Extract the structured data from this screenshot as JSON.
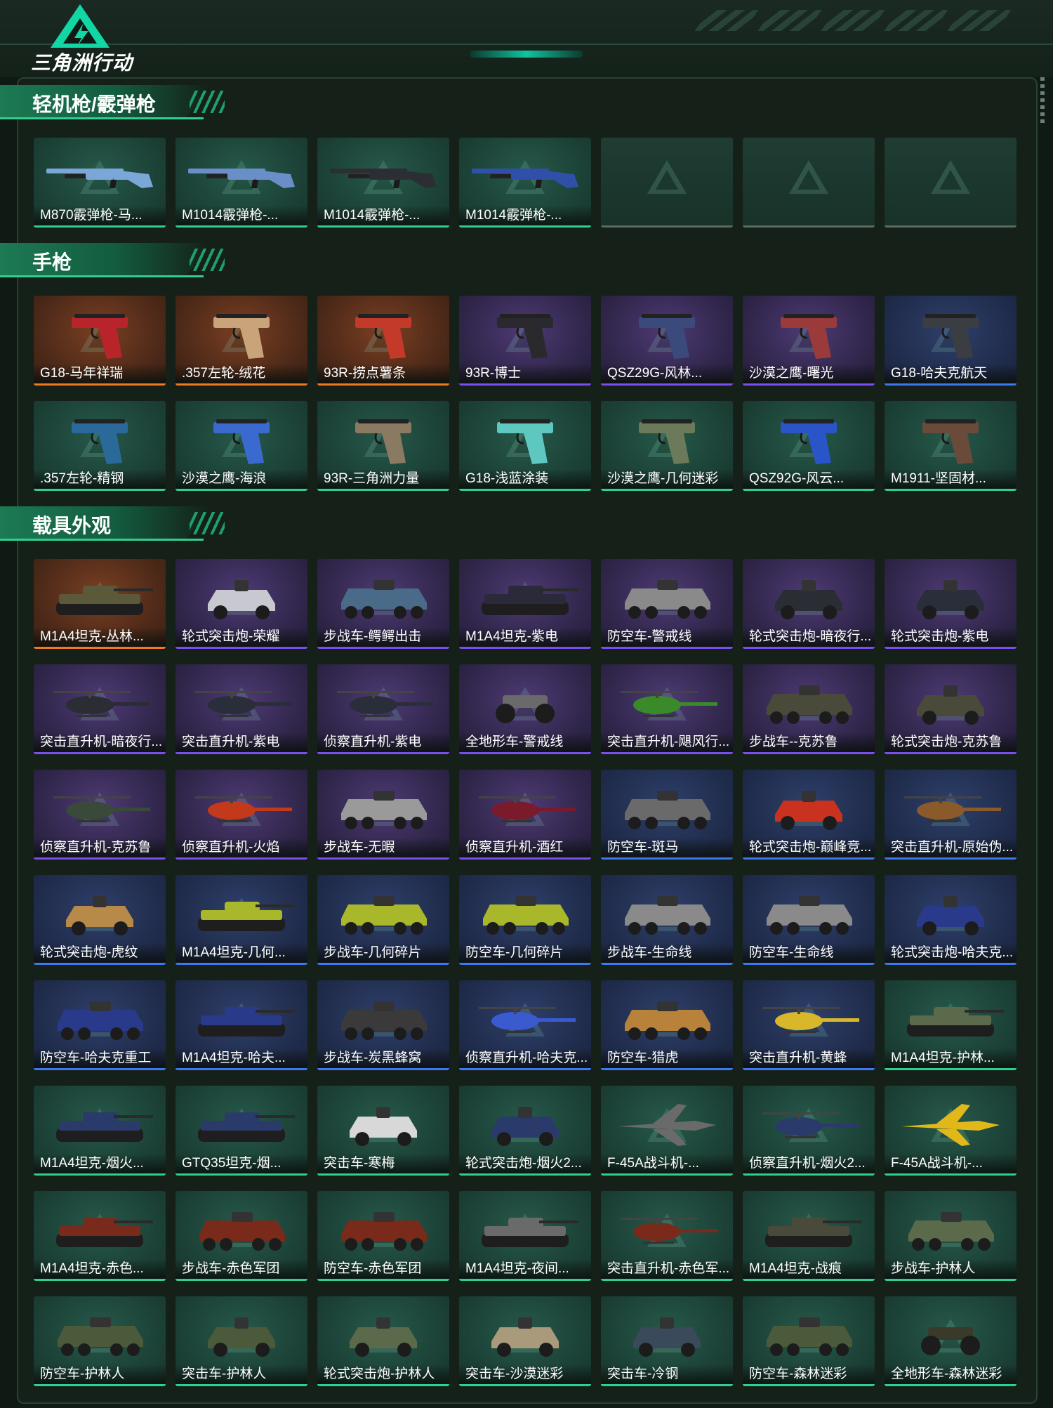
{
  "header": {
    "logo_text": "三角洲行动"
  },
  "sections": [
    {
      "title": "轻机枪/霰弹枪",
      "kind": "gun",
      "items": [
        {
          "name": "M870霰弹枪-马...",
          "rarity": "uncommon",
          "color": "#7aa6d8"
        },
        {
          "name": "M1014霰弹枪-...",
          "rarity": "uncommon",
          "color": "#6a8fc8"
        },
        {
          "name": "M1014霰弹枪-...",
          "rarity": "uncommon",
          "color": "#2b2f33"
        },
        {
          "name": "M1014霰弹枪-...",
          "rarity": "uncommon",
          "color": "#2f4fa8"
        },
        {
          "name": "",
          "rarity": "empty"
        },
        {
          "name": "",
          "rarity": "empty"
        },
        {
          "name": "",
          "rarity": "empty"
        }
      ]
    },
    {
      "title": "手枪",
      "kind": "pistol",
      "items": [
        {
          "name": "G18-马年祥瑞",
          "rarity": "legendary",
          "color": "#b8242a"
        },
        {
          "name": ".357左轮-绒花",
          "rarity": "legendary",
          "color": "#c9a37a"
        },
        {
          "name": "93R-捞点薯条",
          "rarity": "legendary",
          "color": "#c43a2a"
        },
        {
          "name": "93R-博士",
          "rarity": "epic",
          "color": "#2a2a2e"
        },
        {
          "name": "QSZ29G-风林...",
          "rarity": "epic",
          "color": "#3a4a7a"
        },
        {
          "name": "沙漠之鹰-曙光",
          "rarity": "epic",
          "color": "#9a3a3a"
        },
        {
          "name": "G18-哈夫克航天",
          "rarity": "rare",
          "color": "#3a3d42"
        },
        {
          "name": ".357左轮-精钢",
          "rarity": "uncommon",
          "color": "#2a6a9a"
        },
        {
          "name": "沙漠之鹰-海浪",
          "rarity": "uncommon",
          "color": "#3a6ad0"
        },
        {
          "name": "93R-三角洲力量",
          "rarity": "uncommon",
          "color": "#8a7a62"
        },
        {
          "name": "G18-浅蓝涂装",
          "rarity": "uncommon",
          "color": "#5ec8c0"
        },
        {
          "name": "沙漠之鹰-几何迷彩",
          "rarity": "uncommon",
          "color": "#6a7a5a"
        },
        {
          "name": "QSZ92G-风云...",
          "rarity": "uncommon",
          "color": "#2a55c8"
        },
        {
          "name": "M1911-坚固材...",
          "rarity": "uncommon",
          "color": "#6a4a3a"
        }
      ]
    },
    {
      "title": "载具外观",
      "kind": "vehicle",
      "items": [
        {
          "name": "M1A4坦克-丛林...",
          "rarity": "legendary",
          "type": "tank",
          "color": "#5a5a3a"
        },
        {
          "name": "轮式突击炮-荣耀",
          "rarity": "epic",
          "type": "car",
          "color": "#c8c8d0"
        },
        {
          "name": "步战车-鳄鳄出击",
          "rarity": "epic",
          "type": "apc",
          "color": "#4a6a8a"
        },
        {
          "name": "M1A4坦克-紫电",
          "rarity": "epic",
          "type": "tank",
          "color": "#2a2a3a"
        },
        {
          "name": "防空车-警戒线",
          "rarity": "epic",
          "type": "apc",
          "color": "#8a8a8a"
        },
        {
          "name": "轮式突击炮-暗夜行...",
          "rarity": "epic",
          "type": "car",
          "color": "#2a2d33"
        },
        {
          "name": "轮式突击炮-紫电",
          "rarity": "epic",
          "type": "car",
          "color": "#2a2d3a"
        },
        {
          "name": "突击直升机-暗夜行...",
          "rarity": "epic",
          "type": "heli",
          "color": "#2a2d33"
        },
        {
          "name": "突击直升机-紫电",
          "rarity": "epic",
          "type": "heli",
          "color": "#2a2d3a"
        },
        {
          "name": "侦察直升机-紫电",
          "rarity": "epic",
          "type": "heli",
          "color": "#2a2d3a"
        },
        {
          "name": "全地形车-警戒线",
          "rarity": "epic",
          "type": "atv",
          "color": "#6a6a6a"
        },
        {
          "name": "突击直升机-飓风行...",
          "rarity": "epic",
          "type": "heli",
          "color": "#3a8a2a"
        },
        {
          "name": "步战车--克苏鲁",
          "rarity": "epic",
          "type": "apc",
          "color": "#4a4a3a"
        },
        {
          "name": "轮式突击炮-克苏鲁",
          "rarity": "epic",
          "type": "car",
          "color": "#4a4a3a"
        },
        {
          "name": "侦察直升机-克苏鲁",
          "rarity": "epic",
          "type": "heli",
          "color": "#3a4a3a"
        },
        {
          "name": "侦察直升机-火焰",
          "rarity": "epic",
          "type": "heli",
          "color": "#c23a1a"
        },
        {
          "name": "步战车-无暇",
          "rarity": "epic",
          "type": "apc",
          "color": "#9a9a9a"
        },
        {
          "name": "侦察直升机-酒红",
          "rarity": "epic",
          "type": "heli",
          "color": "#7a1a2a"
        },
        {
          "name": "防空车-斑马",
          "rarity": "rare",
          "type": "apc",
          "color": "#6a6a6a"
        },
        {
          "name": "轮式突击炮-巅峰竞...",
          "rarity": "rare",
          "type": "car",
          "color": "#c8321e"
        },
        {
          "name": "突击直升机-原始伪...",
          "rarity": "rare",
          "type": "heli",
          "color": "#8a5a2a"
        },
        {
          "name": "轮式突击炮-虎纹",
          "rarity": "rare",
          "type": "car",
          "color": "#b88a4a"
        },
        {
          "name": "M1A4坦克-几何...",
          "rarity": "rare",
          "type": "tank",
          "color": "#a8b82a"
        },
        {
          "name": "步战车-几何碎片",
          "rarity": "rare",
          "type": "apc",
          "color": "#a8b82a"
        },
        {
          "name": "防空车-几何碎片",
          "rarity": "rare",
          "type": "apc",
          "color": "#a8b82a"
        },
        {
          "name": "步战车-生命线",
          "rarity": "rare",
          "type": "apc",
          "color": "#8a8a8a"
        },
        {
          "name": "防空车-生命线",
          "rarity": "rare",
          "type": "apc",
          "color": "#8a8a8a"
        },
        {
          "name": "轮式突击炮-哈夫克...",
          "rarity": "rare",
          "type": "car",
          "color": "#2a3a8a"
        },
        {
          "name": "防空车-哈夫克重工",
          "rarity": "rare",
          "type": "apc",
          "color": "#2a3a8a"
        },
        {
          "name": "M1A4坦克-哈夫...",
          "rarity": "rare",
          "type": "tank",
          "color": "#2a3a8a"
        },
        {
          "name": "步战车-炭黑蜂窝",
          "rarity": "rare",
          "type": "apc",
          "color": "#3a3a3a"
        },
        {
          "name": "侦察直升机-哈夫克...",
          "rarity": "rare",
          "type": "heli",
          "color": "#3a5ad0"
        },
        {
          "name": "防空车-猎虎",
          "rarity": "rare",
          "type": "apc",
          "color": "#b8823a"
        },
        {
          "name": "突击直升机-黄蜂",
          "rarity": "rare",
          "type": "heli",
          "color": "#d8b82a"
        },
        {
          "name": "M1A4坦克-护林...",
          "rarity": "uncommon",
          "type": "tank",
          "color": "#5a6a4a"
        },
        {
          "name": "M1A4坦克-烟火...",
          "rarity": "uncommon",
          "type": "tank",
          "color": "#2a3a6a"
        },
        {
          "name": "GTQ35坦克-烟...",
          "rarity": "uncommon",
          "type": "tank",
          "color": "#2a3a6a"
        },
        {
          "name": "突击车-寒梅",
          "rarity": "uncommon",
          "type": "car",
          "color": "#d8d8d8"
        },
        {
          "name": "轮式突击炮-烟火2...",
          "rarity": "uncommon",
          "type": "car",
          "color": "#2a3a6a"
        },
        {
          "name": "F-45A战斗机-...",
          "rarity": "uncommon",
          "type": "jet",
          "color": "#6a6a6a"
        },
        {
          "name": "侦察直升机-烟火2...",
          "rarity": "uncommon",
          "type": "heli",
          "color": "#2a3a6a"
        },
        {
          "name": "F-45A战斗机-...",
          "rarity": "uncommon",
          "type": "jet",
          "color": "#e0b81a"
        },
        {
          "name": "M1A4坦克-赤色...",
          "rarity": "uncommon",
          "type": "tank",
          "color": "#7a2a1a"
        },
        {
          "name": "步战车-赤色军团",
          "rarity": "uncommon",
          "type": "apc",
          "color": "#7a2a1a"
        },
        {
          "name": "防空车-赤色军团",
          "rarity": "uncommon",
          "type": "apc",
          "color": "#7a2a1a"
        },
        {
          "name": "M1A4坦克-夜间...",
          "rarity": "uncommon",
          "type": "tank",
          "color": "#6a6a6a"
        },
        {
          "name": "突击直升机-赤色军...",
          "rarity": "uncommon",
          "type": "heli",
          "color": "#7a2a1a"
        },
        {
          "name": "M1A4坦克-战痕",
          "rarity": "uncommon",
          "type": "tank",
          "color": "#4a4a3a"
        },
        {
          "name": "步战车-护林人",
          "rarity": "uncommon",
          "type": "apc",
          "color": "#5a6a4a"
        },
        {
          "name": "防空车-护林人",
          "rarity": "uncommon",
          "type": "apc",
          "color": "#4a5a3a"
        },
        {
          "name": "突击车-护林人",
          "rarity": "uncommon",
          "type": "car",
          "color": "#4a5a3a"
        },
        {
          "name": "轮式突击炮-护林人",
          "rarity": "uncommon",
          "type": "car",
          "color": "#5a6a4a"
        },
        {
          "name": "突击车-沙漠迷彩",
          "rarity": "uncommon",
          "type": "car",
          "color": "#a89a7a"
        },
        {
          "name": "突击车-冷钢",
          "rarity": "uncommon",
          "type": "car",
          "color": "#3a4a5a"
        },
        {
          "name": "防空车-森林迷彩",
          "rarity": "uncommon",
          "type": "apc",
          "color": "#4a5a3a"
        },
        {
          "name": "全地形车-森林迷彩",
          "rarity": "uncommon",
          "type": "atv",
          "color": "#3a3a2a"
        }
      ]
    }
  ]
}
